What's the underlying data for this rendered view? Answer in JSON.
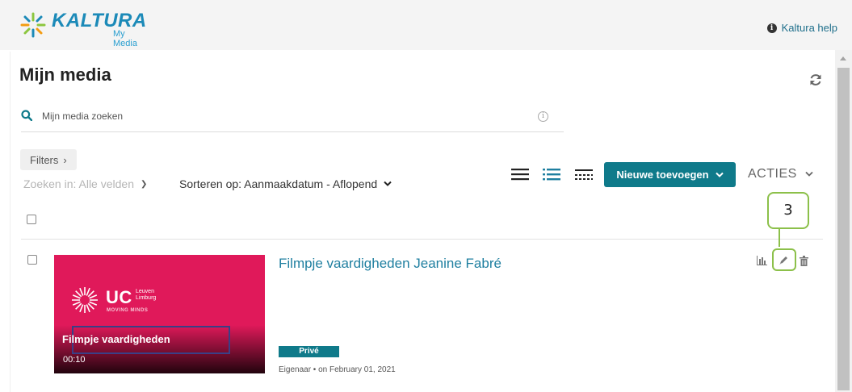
{
  "app": {
    "logo_text": "KALTURA",
    "logo_subtitle": "My Media",
    "help_label": "Kaltura help"
  },
  "page": {
    "title": "Mijn media"
  },
  "search": {
    "placeholder": "Mijn media zoeken"
  },
  "toolbar": {
    "filters_label": "Filters",
    "search_in_label": "Zoeken in: Alle velden",
    "sort_label": "Sorteren op: Aanmaakdatum - Aflopend",
    "add_new_label": "Nieuwe toevoegen",
    "actions_label": "ACTIES",
    "view_modes": [
      "list-view-icon",
      "detailed-list-view-icon",
      "compact-view-icon"
    ]
  },
  "annotation": {
    "callout_number": "3"
  },
  "entries": [
    {
      "title": "Filmpje vaardigheden Jeanine Fabré",
      "thumbnail": {
        "brand": "UC",
        "brand_small": "Leuven Limburg",
        "tagline": "MOVING MINDS",
        "caption": "Filmpje vaardigheden",
        "duration": "00:10"
      },
      "status": "Privé",
      "owner_line": "Eigenaar • on February 01, 2021"
    }
  ],
  "colors": {
    "accent": "#0f7a8a",
    "link": "#1f7fa0",
    "logo": "#1c8ab8",
    "thumbnail_bg": "#e0195a",
    "callout": "#8cc04a"
  }
}
